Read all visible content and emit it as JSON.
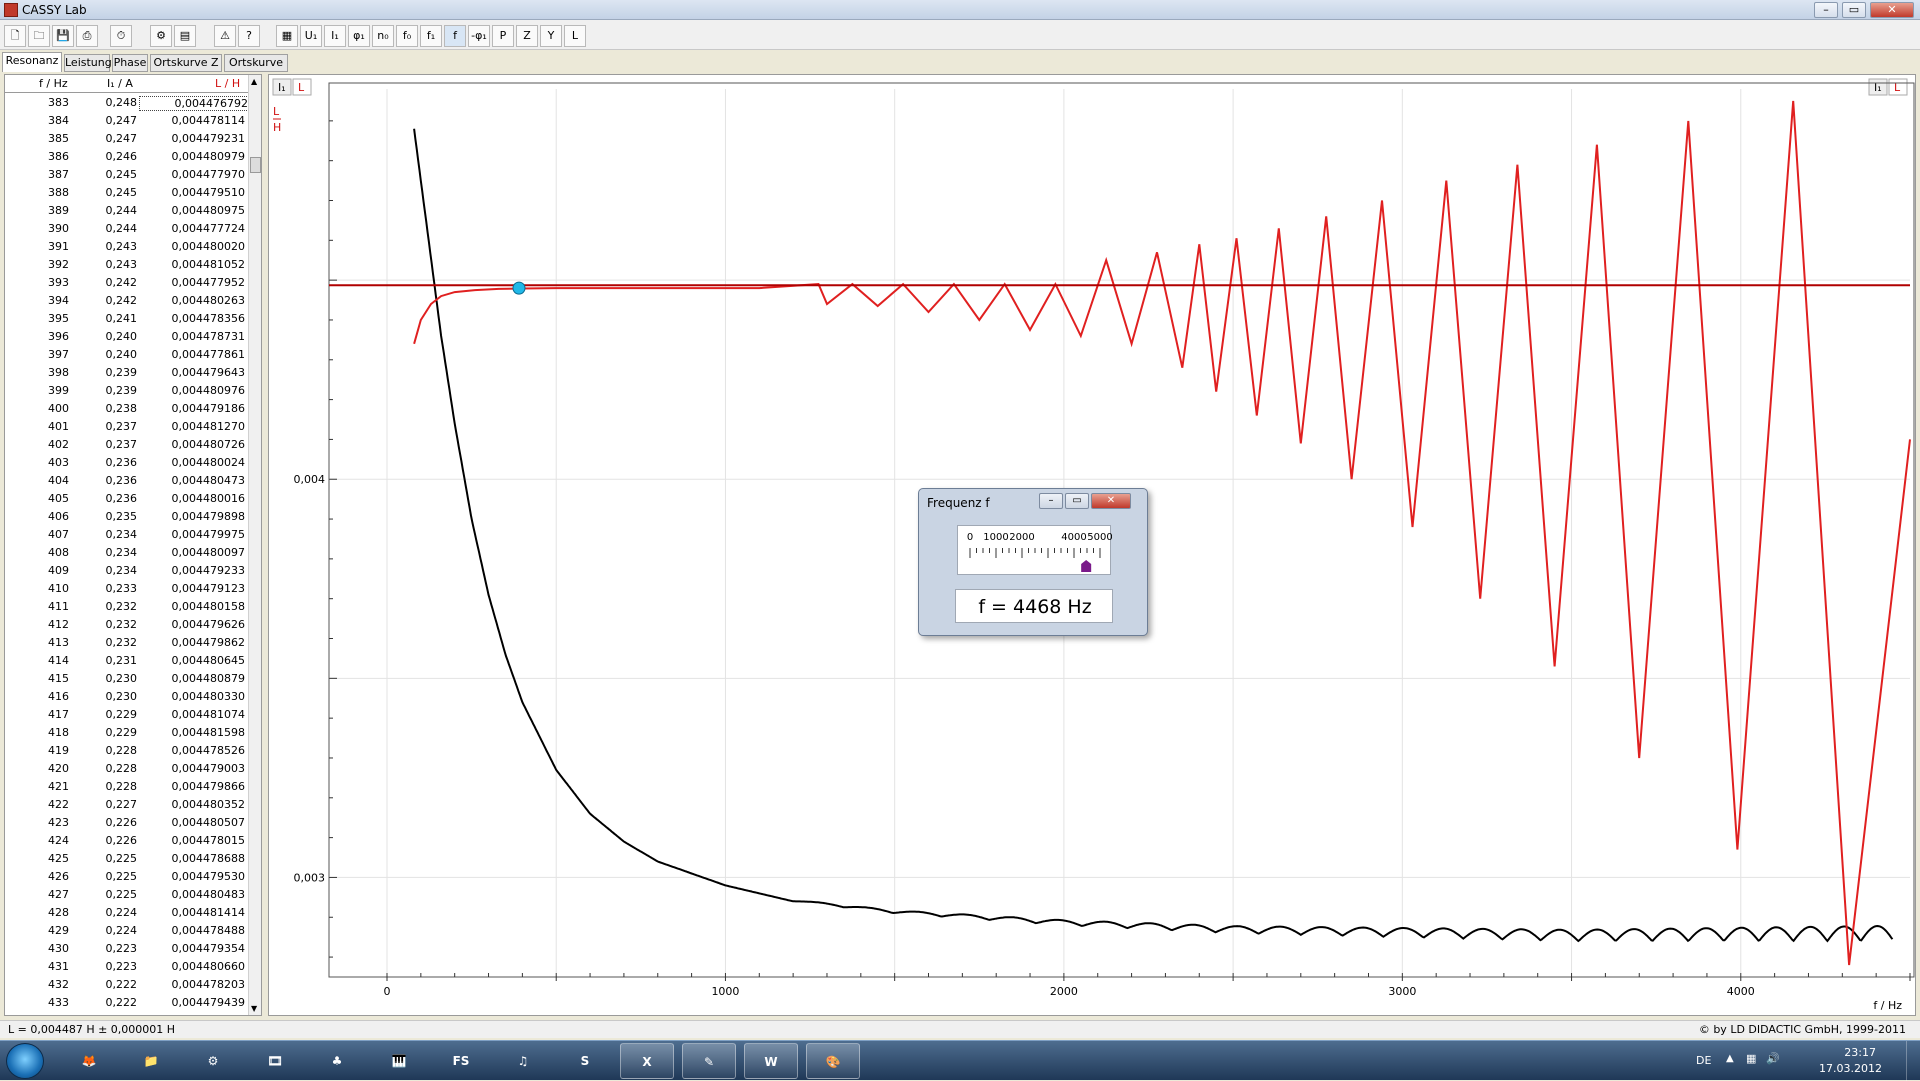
{
  "window": {
    "title": "CASSY Lab"
  },
  "toolbar": {
    "symbols": [
      "U₁",
      "I₁",
      "φ₁",
      "n₀",
      "f₀",
      "f₁",
      "f",
      "-φ₁",
      "P",
      "Z",
      "Y",
      "L"
    ]
  },
  "tabs": [
    "Resonanz",
    "Leistung",
    "Phase",
    "Ortskurve Z",
    "Ortskurve Y"
  ],
  "table": {
    "headers": [
      "f / Hz",
      "I₁ / A",
      "L / H"
    ],
    "rows": [
      [
        "383",
        "0,248",
        "0,004476792"
      ],
      [
        "384",
        "0,247",
        "0,004478114"
      ],
      [
        "385",
        "0,247",
        "0,004479231"
      ],
      [
        "386",
        "0,246",
        "0,004480979"
      ],
      [
        "387",
        "0,245",
        "0,004477970"
      ],
      [
        "388",
        "0,245",
        "0,004479510"
      ],
      [
        "389",
        "0,244",
        "0,004480975"
      ],
      [
        "390",
        "0,244",
        "0,004477724"
      ],
      [
        "391",
        "0,243",
        "0,004480020"
      ],
      [
        "392",
        "0,243",
        "0,004481052"
      ],
      [
        "393",
        "0,242",
        "0,004477952"
      ],
      [
        "394",
        "0,242",
        "0,004480263"
      ],
      [
        "395",
        "0,241",
        "0,004478356"
      ],
      [
        "396",
        "0,240",
        "0,004478731"
      ],
      [
        "397",
        "0,240",
        "0,004477861"
      ],
      [
        "398",
        "0,239",
        "0,004479643"
      ],
      [
        "399",
        "0,239",
        "0,004480976"
      ],
      [
        "400",
        "0,238",
        "0,004479186"
      ],
      [
        "401",
        "0,237",
        "0,004481270"
      ],
      [
        "402",
        "0,237",
        "0,004480726"
      ],
      [
        "403",
        "0,236",
        "0,004480024"
      ],
      [
        "404",
        "0,236",
        "0,004480473"
      ],
      [
        "405",
        "0,236",
        "0,004480016"
      ],
      [
        "406",
        "0,235",
        "0,004479898"
      ],
      [
        "407",
        "0,234",
        "0,004479975"
      ],
      [
        "408",
        "0,234",
        "0,004480097"
      ],
      [
        "409",
        "0,234",
        "0,004479233"
      ],
      [
        "410",
        "0,233",
        "0,004479123"
      ],
      [
        "411",
        "0,232",
        "0,004480158"
      ],
      [
        "412",
        "0,232",
        "0,004479626"
      ],
      [
        "413",
        "0,232",
        "0,004479862"
      ],
      [
        "414",
        "0,231",
        "0,004480645"
      ],
      [
        "415",
        "0,230",
        "0,004480879"
      ],
      [
        "416",
        "0,230",
        "0,004480330"
      ],
      [
        "417",
        "0,229",
        "0,004481074"
      ],
      [
        "418",
        "0,229",
        "0,004481598"
      ],
      [
        "419",
        "0,228",
        "0,004478526"
      ],
      [
        "420",
        "0,228",
        "0,004479003"
      ],
      [
        "421",
        "0,228",
        "0,004479866"
      ],
      [
        "422",
        "0,227",
        "0,004480352"
      ],
      [
        "423",
        "0,226",
        "0,004480507"
      ],
      [
        "424",
        "0,226",
        "0,004478015"
      ],
      [
        "425",
        "0,225",
        "0,004478688"
      ],
      [
        "426",
        "0,225",
        "0,004479530"
      ],
      [
        "427",
        "0,225",
        "0,004480483"
      ],
      [
        "428",
        "0,224",
        "0,004481414"
      ],
      [
        "429",
        "0,224",
        "0,004478488"
      ],
      [
        "430",
        "0,223",
        "0,004479354"
      ],
      [
        "431",
        "0,223",
        "0,004480660"
      ],
      [
        "432",
        "0,222",
        "0,004478203"
      ],
      [
        "433",
        "0,222",
        "0,004479439"
      ]
    ]
  },
  "plot": {
    "tab_left": [
      "I₁",
      "L"
    ],
    "tab_right": [
      "I₁",
      "L"
    ],
    "y_unit_top": "L",
    "y_unit_bottom": "H",
    "x_axis_label": "f / Hz",
    "y_ticks": [
      "0,004",
      "0,003"
    ],
    "x_ticks": [
      "0",
      "1000",
      "2000",
      "3000",
      "4000"
    ],
    "colors": {
      "L": "#e02020",
      "I1": "#000000",
      "fit": "#b00000",
      "cursor": "#20b8e8"
    }
  },
  "chart_data": {
    "type": "line",
    "title": "",
    "xlabel": "f / Hz",
    "ylabel": "L / H",
    "xlim": [
      -130,
      4500
    ],
    "ylim": [
      0.00276,
      0.00498
    ],
    "grid": true,
    "series": [
      {
        "name": "L",
        "color": "#e02020",
        "x": [
          80,
          100,
          130,
          160,
          200,
          260,
          330,
          400,
          500,
          700,
          900,
          1100,
          1300,
          1500,
          1700,
          1900,
          2100,
          2300,
          2500,
          2700,
          2900,
          3100,
          3300,
          3500,
          3700,
          3900,
          4100,
          4300,
          4400,
          4468
        ],
        "y": [
          0.00434,
          0.0044,
          0.00444,
          0.00446,
          0.00447,
          0.004475,
          0.004478,
          0.004479,
          0.00448,
          0.00448,
          0.00448,
          0.00448,
          0.00448,
          0.00448,
          0.00448,
          0.00448,
          0.00448,
          0.00448,
          0.00448,
          0.00448,
          0.00448,
          0.00448,
          0.00448,
          0.00448,
          0.00448,
          0.00448,
          0.00448,
          0.00448,
          0.00448,
          0.00448
        ],
        "resonance_dips": {
          "f": [
            1300,
            1450,
            1600,
            1750,
            1900,
            2050,
            2200,
            2350,
            2450,
            2570,
            2700,
            2850,
            3030,
            3230,
            3450,
            3700,
            3990,
            4320
          ],
          "L_min": [
            0.00444,
            0.004435,
            0.00442,
            0.0044,
            0.004375,
            0.00436,
            0.00434,
            0.00428,
            0.00422,
            0.00416,
            0.00409,
            0.004,
            0.00388,
            0.0037,
            0.00353,
            0.0033,
            0.00307,
            0.00278
          ]
        },
        "resonance_peaks": {
          "f": [
            2200,
            2350,
            2450,
            2570,
            2700,
            2850,
            3030,
            3230,
            3450,
            3700,
            3990,
            4300
          ],
          "L_max": [
            0.00455,
            0.00457,
            0.00459,
            0.004605,
            0.00463,
            0.00466,
            0.0047,
            0.00475,
            0.00479,
            0.00484,
            0.0049,
            0.00495
          ]
        },
        "end_point": {
          "f": 4500,
          "L": 0.0041
        }
      },
      {
        "name": "I₁",
        "color": "#000000",
        "x": [
          80,
          120,
          160,
          200,
          250,
          300,
          350,
          400,
          500,
          600,
          700,
          800,
          1000,
          1200,
          1500,
          2000,
          2500,
          3000,
          3500,
          4000,
          4450
        ],
        "y_pixel_scale_note": "",
        "y": [
          0.00488,
          0.00462,
          0.00436,
          0.00414,
          0.0039,
          0.00371,
          0.00356,
          0.00344,
          0.00327,
          0.00316,
          0.00309,
          0.00304,
          0.00298,
          0.00294,
          0.00291,
          0.00288,
          0.00286,
          0.00285,
          0.00284,
          0.00284,
          0.00284
        ]
      },
      {
        "name": "fit L",
        "color": "#b00000",
        "x": [
          -130,
          4500
        ],
        "y": [
          0.004487,
          0.004487
        ]
      }
    ],
    "cursor": {
      "f": 390,
      "L": 0.00448
    }
  },
  "freq_window": {
    "title": "Frequenz f",
    "scale_labels": [
      "0",
      "1000",
      "2000",
      "4000",
      "5000"
    ],
    "display": "f =  4468 Hz",
    "value_hz": 4468,
    "range_hz": [
      0,
      5000
    ]
  },
  "status": {
    "left": "L = 0,004487 H ± 0,000001 H",
    "right": "© by LD DIDACTIC GmbH, 1999-2011"
  },
  "taskbar": {
    "items": [
      "firefox-icon",
      "explorer-icon",
      "steam-icon",
      "media-icon",
      "games-icon",
      "piano-icon",
      "FS",
      "itunes-icon",
      "skype-icon",
      "excel-icon",
      "cassy-icon",
      "word-icon",
      "paint-icon"
    ],
    "lang": "DE",
    "time": "23:17",
    "date": "17.03.2012"
  }
}
